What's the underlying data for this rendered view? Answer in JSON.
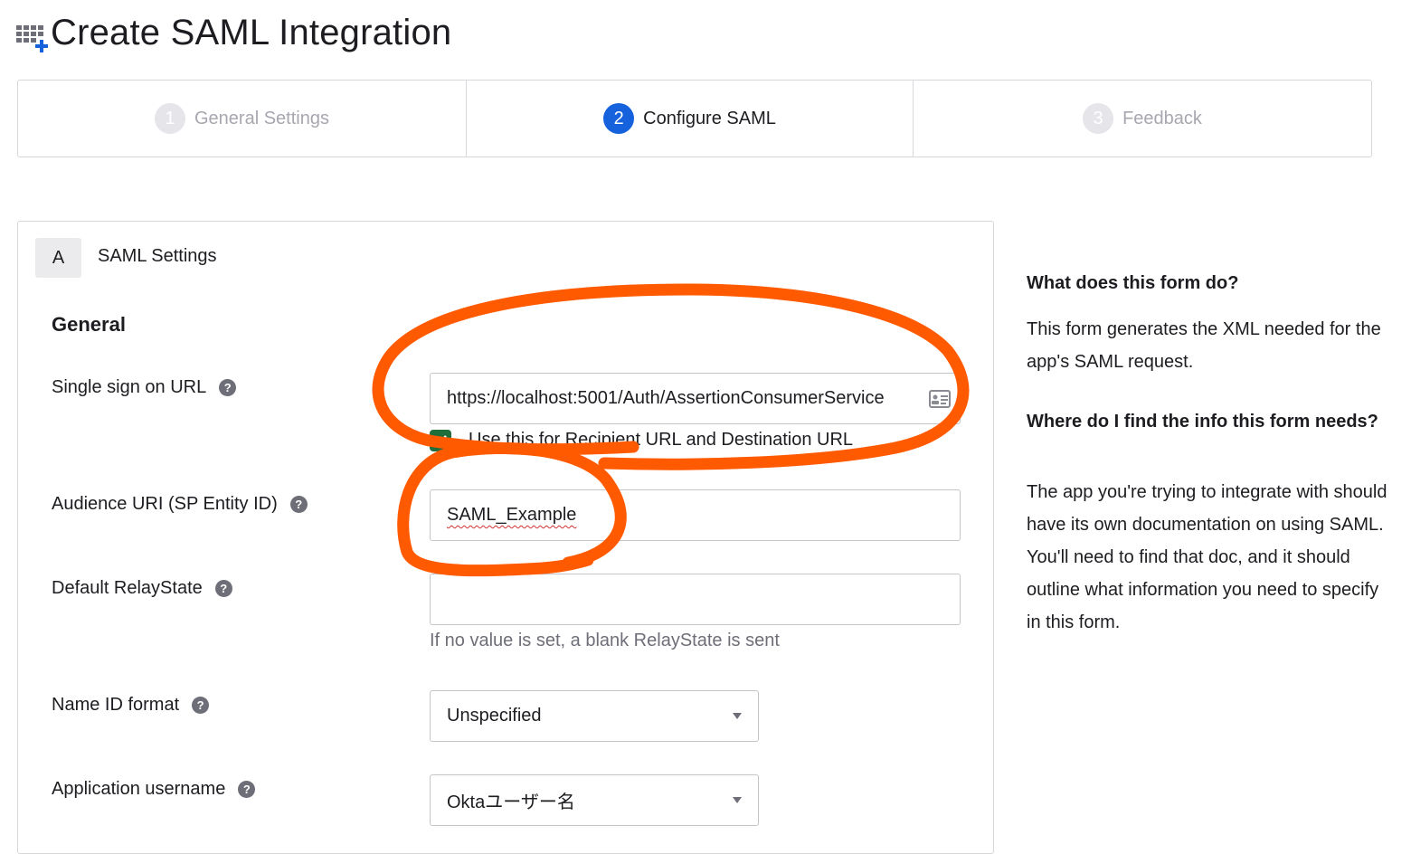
{
  "header": {
    "title": "Create SAML Integration",
    "icon": "grid-plus-icon"
  },
  "stepper": {
    "steps": [
      {
        "number": "1",
        "label": "General Settings",
        "state": "inactive"
      },
      {
        "number": "2",
        "label": "Configure SAML",
        "state": "active"
      },
      {
        "number": "3",
        "label": "Feedback",
        "state": "inactive"
      }
    ]
  },
  "section": {
    "badge": "A",
    "title": "SAML Settings",
    "subtitle": "General"
  },
  "form": {
    "sso_url": {
      "label": "Single sign on URL",
      "value": "https://localhost:5001/Auth/AssertionConsumerService"
    },
    "recipient_checkbox": {
      "label": "Use this for Recipient URL and Destination URL",
      "checked": true
    },
    "audience_uri": {
      "label": "Audience URI (SP Entity ID)",
      "value": "SAML_Example"
    },
    "relay_state": {
      "label": "Default RelayState",
      "value": "",
      "hint": "If no value is set, a blank RelayState is sent"
    },
    "name_id_format": {
      "label": "Name ID format",
      "selected": "Unspecified"
    },
    "app_username": {
      "label": "Application username",
      "selected": "Oktaユーザー名"
    },
    "help_glyph": "?"
  },
  "help": {
    "q1": "What does this form do?",
    "a1": "This form generates the XML needed for the app's SAML request.",
    "q2": "Where do I find the info this form needs?",
    "a2": "The app you're trying to integrate with should have its own documentation on using SAML. You'll need to find that doc, and it should outline what information you need to specify in this form."
  },
  "colors": {
    "accent": "#1662dd",
    "annotation": "#ff5a00",
    "checkbox": "#1f6e3b"
  }
}
